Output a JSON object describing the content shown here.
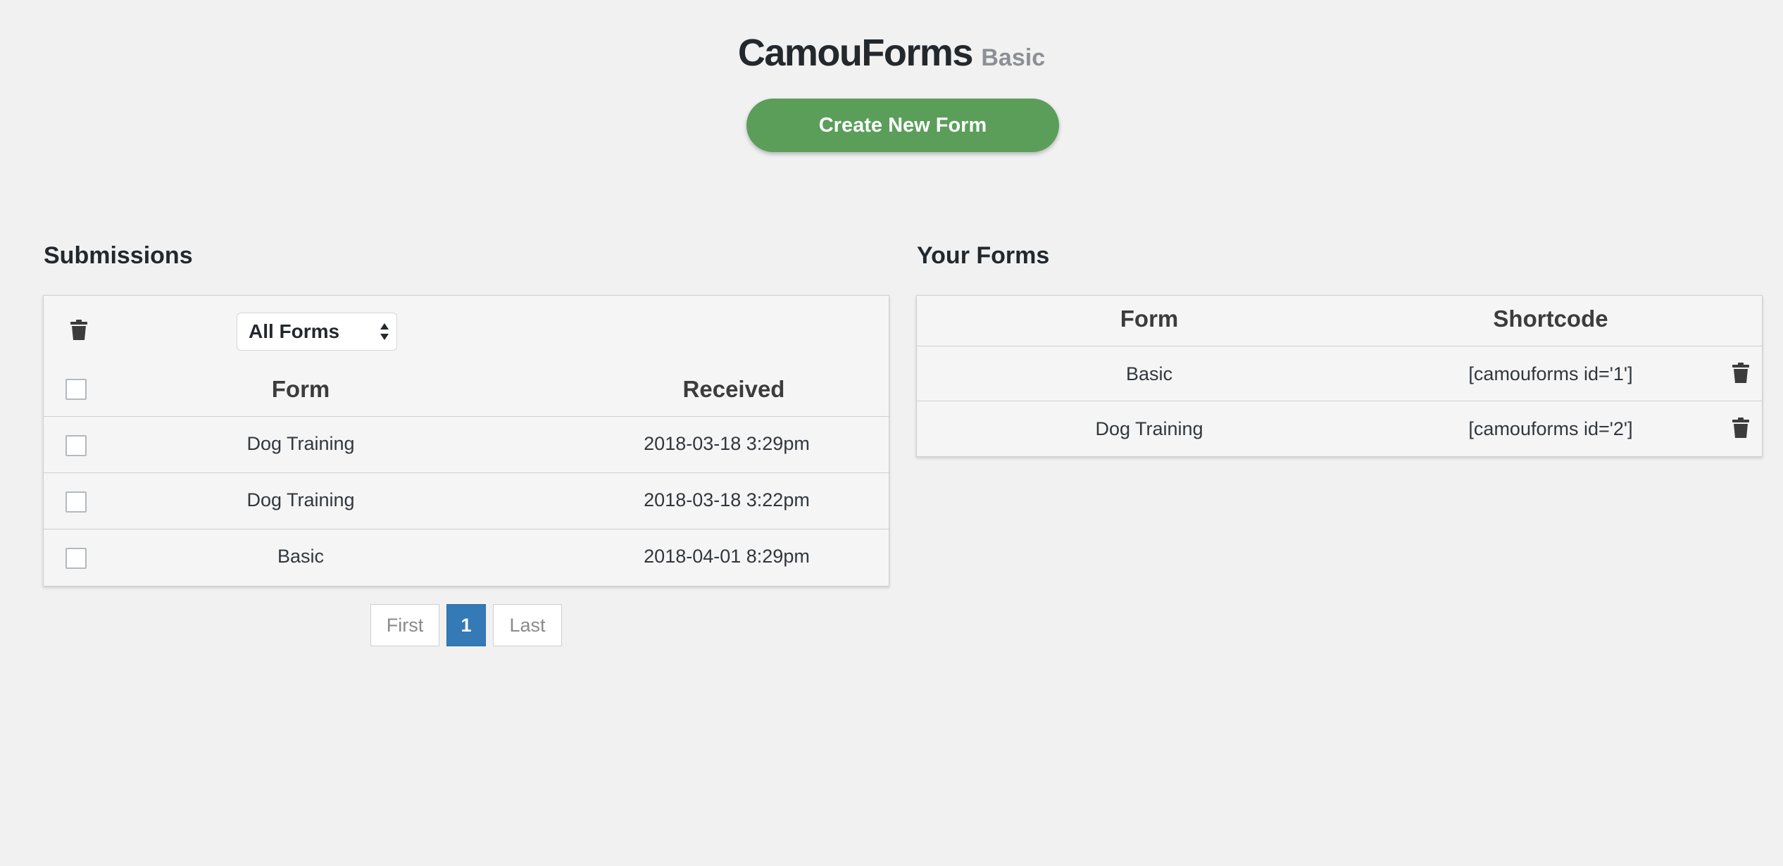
{
  "header": {
    "brand_name": "CamouForms",
    "plan": "Basic",
    "create_button": "Create New Form"
  },
  "submissions": {
    "title": "Submissions",
    "filter_selected": "All Forms",
    "columns": {
      "form": "Form",
      "received": "Received"
    },
    "rows": [
      {
        "form": "Dog Training",
        "received": "2018-03-18 3:29pm"
      },
      {
        "form": "Dog Training",
        "received": "2018-03-18 3:22pm"
      },
      {
        "form": "Basic",
        "received": "2018-04-01 8:29pm"
      }
    ],
    "pagination": {
      "first": "First",
      "current": "1",
      "last": "Last"
    }
  },
  "forms": {
    "title": "Your Forms",
    "columns": {
      "form": "Form",
      "shortcode": "Shortcode"
    },
    "rows": [
      {
        "form": "Basic",
        "shortcode": "[camouforms id='1']"
      },
      {
        "form": "Dog Training",
        "shortcode": "[camouforms id='2']"
      }
    ]
  },
  "icons": {
    "delete": "trash-icon",
    "select": "select-arrows-icon"
  },
  "colors": {
    "primary_button": "#5a9e5a",
    "active_page": "#337ab7",
    "background": "#f1f1f1"
  }
}
